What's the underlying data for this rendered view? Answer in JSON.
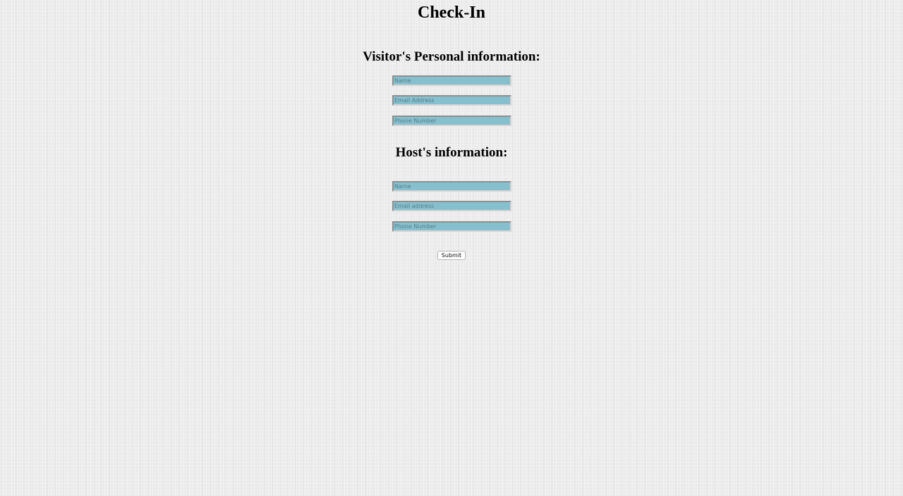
{
  "page": {
    "title": "Check-In"
  },
  "visitor": {
    "heading": "Visitor's Personal information:",
    "name_placeholder": "Name",
    "email_placeholder": "Email Address",
    "phone_placeholder": "Phone Number",
    "name_value": "",
    "email_value": "",
    "phone_value": ""
  },
  "host": {
    "heading": "Host's information:",
    "name_placeholder": "Name",
    "email_placeholder": "Email address",
    "phone_placeholder": "Phone Number",
    "name_value": "",
    "email_value": "",
    "phone_value": ""
  },
  "form": {
    "submit_label": "Submit"
  },
  "colors": {
    "input_background": "#86c0ce",
    "page_background": "#ededed"
  }
}
